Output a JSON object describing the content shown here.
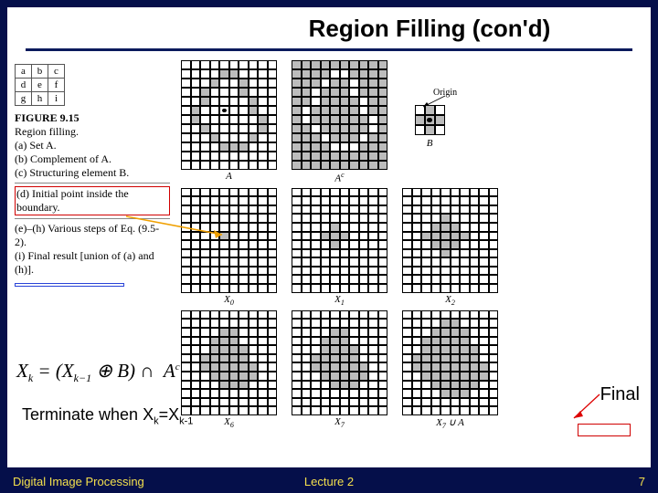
{
  "title": "Region Filling (con'd)",
  "abc": {
    "r1": [
      "a",
      "b",
      "c"
    ],
    "r2": [
      "d",
      "e",
      "f"
    ],
    "r3": [
      "g",
      "h",
      "i"
    ]
  },
  "figure": {
    "label": "FIGURE 9.15",
    "heading": "Region filling.",
    "a": "(a) Set A.",
    "b": "(b) Complement of A.",
    "c": "(c) Structuring element B.",
    "d": "(d) Initial point inside the boundary.",
    "e": "(e)–(h) Various steps of Eq. (9.5-2).",
    "i": "(i) Final result [union of (a) and (h)]."
  },
  "equation": "X_k = (X_{k-1} ⊕ B) ∩ A^c",
  "terminate": {
    "prefix": "Terminate when X",
    "k": "k",
    "eq": "=X",
    "k1": "k-1"
  },
  "final_label": "Final",
  "grid_labels": {
    "A": "A",
    "Ac": "A",
    "Ac_sup": "c",
    "B": "B",
    "origin": "Origin",
    "X0": "X",
    "X0s": "0",
    "X1": "X",
    "X1s": "1",
    "X2": "X",
    "X2s": "2",
    "X6": "X",
    "X6s": "6",
    "X7": "X",
    "X7s": "7",
    "X7U": "X",
    "X7Us": "7",
    "union": " ∪ A"
  },
  "footer": {
    "left": "Digital Image Processing",
    "center": "Lecture 2",
    "page": "7"
  },
  "chart_data": {
    "type": "table",
    "description": "Morphological region filling (Figure 9.15). Nine panels showing set A, its complement, a cross structuring element B, and dilation iterations X0..X7 plus final union. Grid A is 10 cols × 12 rows with a closed boundary of grey cells; complement inverts it; B is a 3×3 cross with origin at center.",
    "A_boundary_rc": [
      [
        1,
        4
      ],
      [
        1,
        5
      ],
      [
        2,
        3
      ],
      [
        2,
        6
      ],
      [
        3,
        2
      ],
      [
        3,
        6
      ],
      [
        4,
        2
      ],
      [
        4,
        7
      ],
      [
        5,
        1
      ],
      [
        5,
        7
      ],
      [
        6,
        1
      ],
      [
        6,
        8
      ],
      [
        7,
        2
      ],
      [
        7,
        8
      ],
      [
        8,
        3
      ],
      [
        8,
        7
      ],
      [
        9,
        4
      ],
      [
        9,
        5
      ],
      [
        9,
        6
      ]
    ],
    "X0_rc": [
      [
        5,
        4
      ]
    ],
    "X1_rc": [
      [
        4,
        4
      ],
      [
        5,
        3
      ],
      [
        5,
        4
      ],
      [
        5,
        5
      ],
      [
        6,
        4
      ]
    ],
    "X2_rc": [
      [
        3,
        4
      ],
      [
        4,
        3
      ],
      [
        4,
        4
      ],
      [
        4,
        5
      ],
      [
        5,
        2
      ],
      [
        5,
        3
      ],
      [
        5,
        4
      ],
      [
        5,
        5
      ],
      [
        5,
        6
      ],
      [
        6,
        3
      ],
      [
        6,
        4
      ],
      [
        6,
        5
      ],
      [
        7,
        4
      ]
    ],
    "X6_rc": [
      [
        2,
        4
      ],
      [
        2,
        5
      ],
      [
        3,
        3
      ],
      [
        3,
        4
      ],
      [
        3,
        5
      ],
      [
        4,
        3
      ],
      [
        4,
        4
      ],
      [
        4,
        5
      ],
      [
        4,
        6
      ],
      [
        5,
        2
      ],
      [
        5,
        3
      ],
      [
        5,
        4
      ],
      [
        5,
        5
      ],
      [
        5,
        6
      ],
      [
        6,
        2
      ],
      [
        6,
        3
      ],
      [
        6,
        4
      ],
      [
        6,
        5
      ],
      [
        6,
        6
      ],
      [
        6,
        7
      ],
      [
        7,
        3
      ],
      [
        7,
        4
      ],
      [
        7,
        5
      ],
      [
        7,
        6
      ],
      [
        7,
        7
      ],
      [
        8,
        4
      ],
      [
        8,
        5
      ],
      [
        8,
        6
      ]
    ],
    "X7_rc": [
      [
        2,
        4
      ],
      [
        2,
        5
      ],
      [
        3,
        3
      ],
      [
        3,
        4
      ],
      [
        3,
        5
      ],
      [
        4,
        3
      ],
      [
        4,
        4
      ],
      [
        4,
        5
      ],
      [
        4,
        6
      ],
      [
        5,
        2
      ],
      [
        5,
        3
      ],
      [
        5,
        4
      ],
      [
        5,
        5
      ],
      [
        5,
        6
      ],
      [
        6,
        2
      ],
      [
        6,
        3
      ],
      [
        6,
        4
      ],
      [
        6,
        5
      ],
      [
        6,
        6
      ],
      [
        6,
        7
      ],
      [
        7,
        3
      ],
      [
        7,
        4
      ],
      [
        7,
        5
      ],
      [
        7,
        6
      ],
      [
        7,
        7
      ],
      [
        8,
        4
      ],
      [
        8,
        5
      ],
      [
        8,
        6
      ]
    ],
    "grid_shape": {
      "rows": 12,
      "cols": 10
    },
    "B_shape": {
      "rows": 3,
      "cols": 3,
      "cells": [
        [
          0,
          1
        ],
        [
          1,
          0
        ],
        [
          1,
          1
        ],
        [
          1,
          2
        ],
        [
          2,
          1
        ]
      ],
      "origin": [
        1,
        1
      ]
    }
  }
}
